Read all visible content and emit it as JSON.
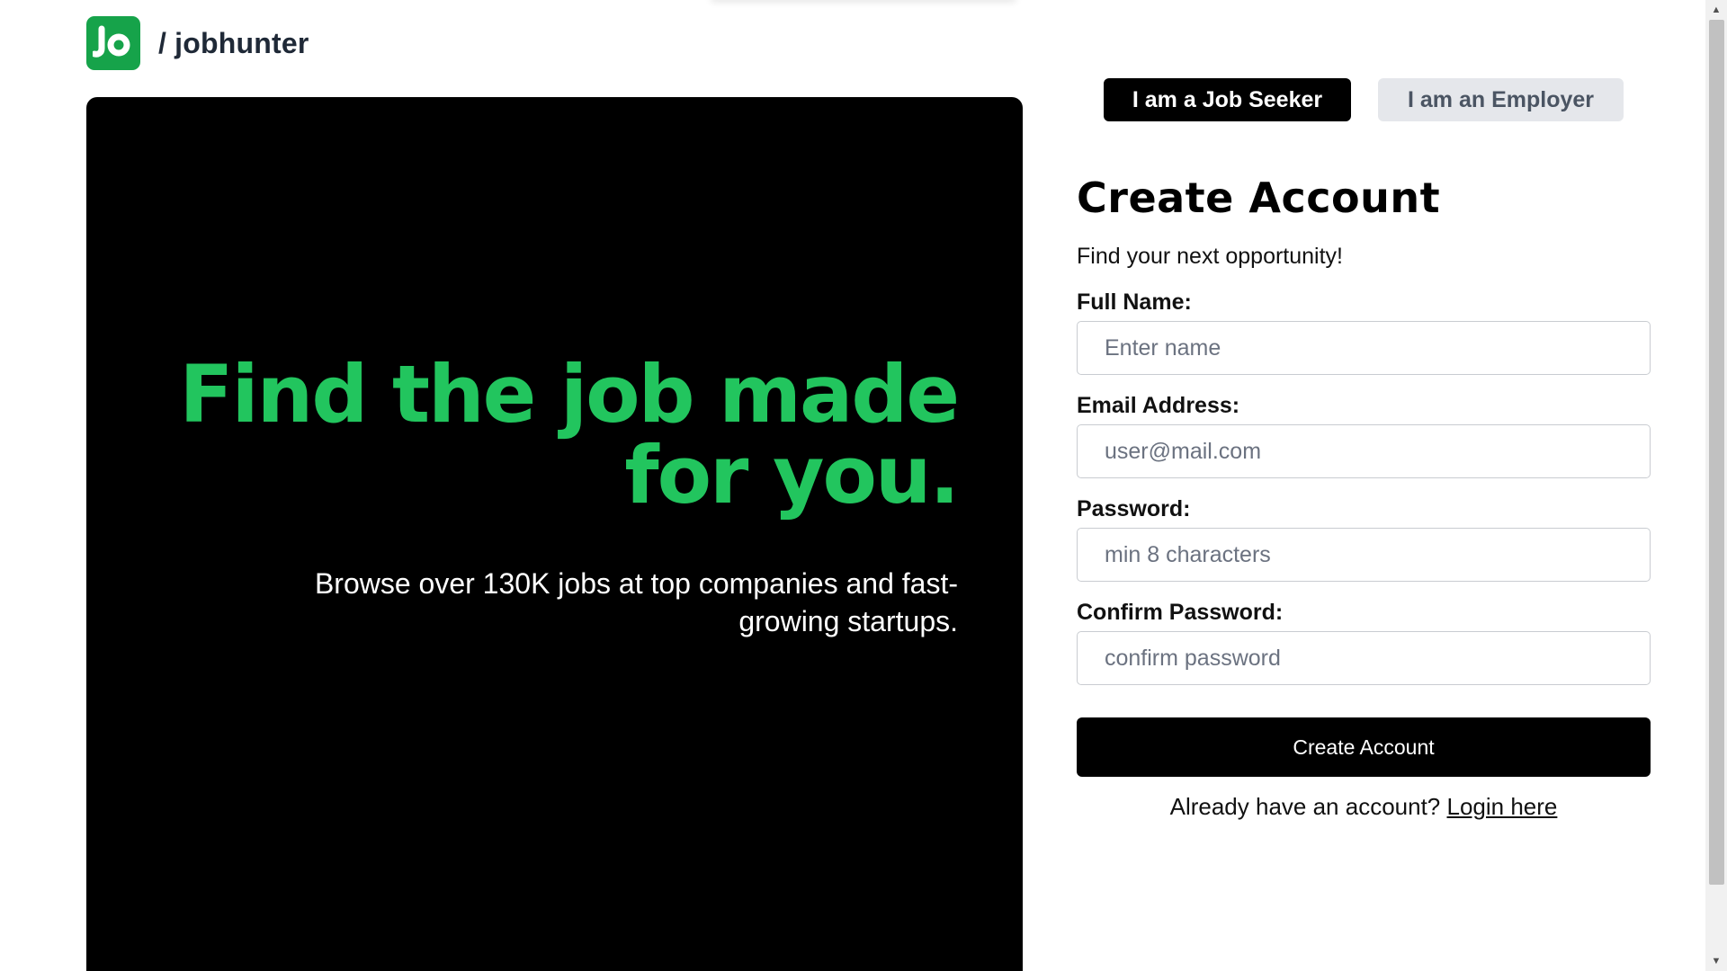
{
  "brand": {
    "logo_text": "Jo",
    "name": "/ jobhunter",
    "logo_color": "#16a34a"
  },
  "hero": {
    "title": "Find the job made for you.",
    "subtitle": "Browse over 130K jobs at top companies and fast-growing startups.",
    "accent_color": "#22c55e"
  },
  "role_switch": {
    "seeker_label": "I am a Job Seeker",
    "employer_label": "I am an Employer",
    "selected": "seeker"
  },
  "form": {
    "title": "Create Account",
    "subtitle": "Find your next opportunity!",
    "fields": [
      {
        "label": "Full Name:",
        "placeholder": "Enter name",
        "value": ""
      },
      {
        "label": "Email Address:",
        "placeholder": "user@mail.com",
        "value": ""
      },
      {
        "label": "Password:",
        "placeholder": "min 8 characters",
        "value": ""
      },
      {
        "label": "Confirm Password:",
        "placeholder": "confirm password",
        "value": ""
      }
    ],
    "submit_label": "Create Account",
    "login_prompt": "Already have an account?",
    "login_link": "Login here"
  },
  "scrollbar": {
    "up_icon": "arrow-up-icon",
    "down_icon": "arrow-down-icon"
  }
}
